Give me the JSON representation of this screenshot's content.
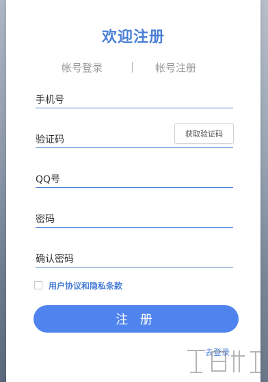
{
  "header": {
    "title": "欢迎注册"
  },
  "tabs": {
    "login": "帐号登录",
    "separator": "|",
    "register": "帐号注册"
  },
  "form": {
    "phone_placeholder": "手机号",
    "code_placeholder": "验证码",
    "code_button": "获取验证码",
    "qq_placeholder": "QQ号",
    "password_placeholder": "密码",
    "confirm_placeholder": "确认密码"
  },
  "agreement": {
    "checked": false,
    "label": "用户协议和隐私条款"
  },
  "actions": {
    "submit_label": "注 册",
    "goto_login": "去登录"
  },
  "colors": {
    "accent": "#4a7fd6",
    "button": "#4f84ee"
  }
}
